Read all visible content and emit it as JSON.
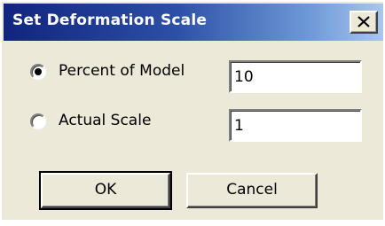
{
  "dialog": {
    "title": "Set Deformation Scale",
    "close_label": "×"
  },
  "options": [
    {
      "label": "Percent of Model",
      "value": "10",
      "selected": true
    },
    {
      "label": "Actual Scale",
      "value": "1",
      "selected": false
    }
  ],
  "buttons": {
    "ok_label": "OK",
    "cancel_label": "Cancel"
  },
  "colors": {
    "title_gradient_start": "#11247e",
    "title_gradient_end": "#a8c6ee",
    "dialog_face": "#ece9d8"
  }
}
